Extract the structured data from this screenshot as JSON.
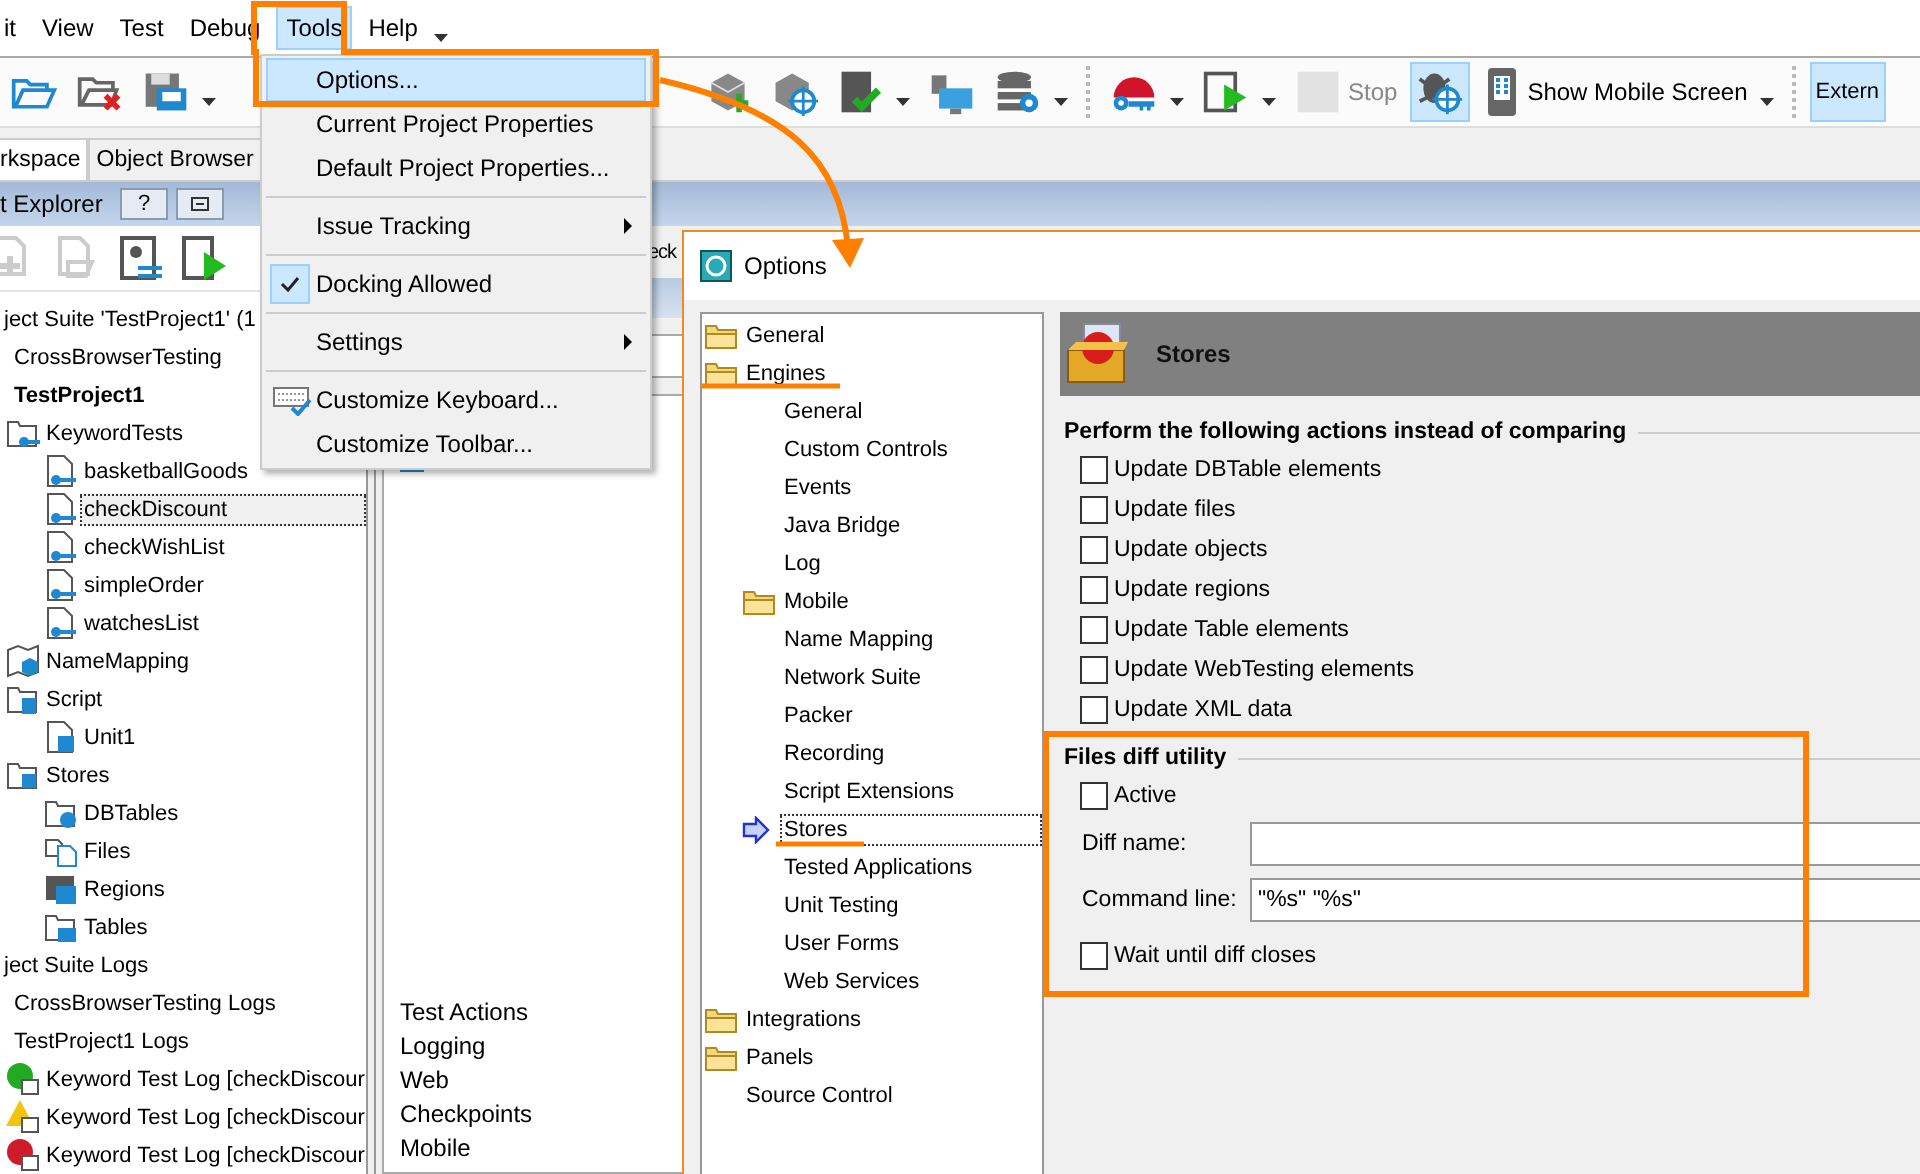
{
  "menu_bar": {
    "items": [
      {
        "label": "it",
        "selected": false
      },
      {
        "label": "View",
        "selected": false
      },
      {
        "label": "Test",
        "selected": false
      },
      {
        "label": "Debug",
        "selected": false
      },
      {
        "label": "Tools",
        "selected": true
      },
      {
        "label": "Help",
        "selected": false
      }
    ]
  },
  "toolbar": {
    "left": [
      {
        "kind": "open"
      },
      {
        "kind": "close"
      },
      {
        "kind": "save",
        "dropdown": true
      }
    ],
    "right": [
      {
        "kind": "cube-add"
      },
      {
        "kind": "cube-target"
      },
      {
        "kind": "check-doc",
        "dropdown": true
      },
      {
        "kind": "monitor"
      },
      {
        "kind": "db-gear",
        "dropdown": true
      },
      {
        "kind": "separator"
      },
      {
        "kind": "key",
        "dropdown": true
      },
      {
        "kind": "play-doc",
        "dropdown": true
      },
      {
        "kind": "stop",
        "label": "Stop",
        "disabled": true
      },
      {
        "kind": "bug-target",
        "pressed": true
      },
      {
        "kind": "phone",
        "label": "Show Mobile Screen",
        "dropdown": true
      },
      {
        "kind": "separator"
      },
      {
        "kind": "text",
        "label": "Extern",
        "pressed": true
      }
    ]
  },
  "tabs": [
    {
      "label": "rkspace",
      "selected": true
    },
    {
      "label": "Object Browser",
      "selected": false
    }
  ],
  "project_explorer": {
    "title": "t Explorer",
    "help_button": "?",
    "toolbar": [
      {
        "kind": "add",
        "disabled": true
      },
      {
        "kind": "import",
        "disabled": true
      },
      {
        "kind": "run-list",
        "disabled": false
      },
      {
        "kind": "run",
        "disabled": false
      }
    ],
    "tree": [
      {
        "label": "ject Suite 'TestProject1' (1",
        "selected": false,
        "children": [
          {
            "label": "CrossBrowserTesting",
            "selected": false
          },
          {
            "label": "TestProject1",
            "kind": "active-project",
            "selected": false,
            "children": [
              {
                "label": "KeywordTests",
                "kind": "keyword-folder",
                "selected": false,
                "children": [
                  {
                    "label": "basketballGoods",
                    "kind": "keyword-test",
                    "selected": false
                  },
                  {
                    "label": "checkDiscount",
                    "kind": "keyword-test",
                    "selected": true
                  },
                  {
                    "label": "checkWishList",
                    "kind": "keyword-test",
                    "selected": false
                  },
                  {
                    "label": "simpleOrder",
                    "kind": "keyword-test",
                    "selected": false
                  },
                  {
                    "label": "watchesList",
                    "kind": "keyword-test",
                    "selected": false
                  }
                ]
              },
              {
                "label": "NameMapping",
                "kind": "map",
                "selected": false
              },
              {
                "label": "Script",
                "kind": "script-folder",
                "selected": false,
                "children": [
                  {
                    "label": "Unit1",
                    "kind": "script",
                    "selected": false
                  }
                ]
              },
              {
                "label": "Stores",
                "kind": "stores",
                "selected": false,
                "children": [
                  {
                    "label": "DBTables",
                    "kind": "db-folder",
                    "selected": false
                  },
                  {
                    "label": "Files",
                    "kind": "files",
                    "selected": false
                  },
                  {
                    "label": "Regions",
                    "kind": "regions",
                    "selected": false
                  },
                  {
                    "label": "Tables",
                    "kind": "table-folder",
                    "selected": false
                  }
                ]
              }
            ]
          }
        ]
      },
      {
        "label": "ject Suite Logs",
        "selected": false,
        "children": [
          {
            "label": "CrossBrowserTesting Logs",
            "selected": false
          },
          {
            "label": "TestProject1 Logs",
            "selected": false,
            "children": [
              {
                "label": "Keyword Test Log [checkDiscour",
                "kind": "log-passed",
                "selected": false
              },
              {
                "label": "Keyword Test Log [checkDiscour",
                "kind": "log-warning",
                "selected": false
              },
              {
                "label": "Keyword Test Log [checkDiscour",
                "kind": "log-failed",
                "selected": false
              }
            ]
          }
        ]
      }
    ]
  },
  "middle_panel": {
    "tab": "eck",
    "items": [
      "Test Actions",
      "Logging",
      "Web",
      "Checkpoints",
      "Mobile"
    ]
  },
  "tools_menu": {
    "items": [
      {
        "kind": "item",
        "label": "Options...",
        "selected": true
      },
      {
        "kind": "item",
        "label": "Current Project Properties",
        "selected": false
      },
      {
        "kind": "item",
        "label": "Default Project Properties...",
        "selected": false
      },
      {
        "kind": "separator"
      },
      {
        "kind": "submenu",
        "label": "Issue Tracking",
        "selected": false
      },
      {
        "kind": "separator"
      },
      {
        "kind": "check",
        "label": "Docking Allowed",
        "checked": true,
        "selected": false
      },
      {
        "kind": "separator"
      },
      {
        "kind": "submenu",
        "label": "Settings",
        "selected": false
      },
      {
        "kind": "separator"
      },
      {
        "kind": "keyboard",
        "label": "Customize Keyboard...",
        "selected": false
      },
      {
        "kind": "item",
        "label": "Customize Toolbar...",
        "selected": false
      }
    ]
  },
  "options_dialog": {
    "title": "Options",
    "tree": [
      {
        "label": "General",
        "kind": "folder",
        "selected": false
      },
      {
        "label": "Engines",
        "kind": "folder",
        "selected": false,
        "children": [
          {
            "label": "General",
            "kind": "page",
            "selected": false
          },
          {
            "label": "Custom Controls",
            "kind": "page",
            "selected": false
          },
          {
            "label": "Events",
            "kind": "page",
            "selected": false
          },
          {
            "label": "Java Bridge",
            "kind": "page",
            "selected": false
          },
          {
            "label": "Log",
            "kind": "page",
            "selected": false
          },
          {
            "label": "Mobile",
            "kind": "folder",
            "selected": false
          },
          {
            "label": "Name Mapping",
            "kind": "page",
            "selected": false
          },
          {
            "label": "Network Suite",
            "kind": "page",
            "selected": false
          },
          {
            "label": "Packer",
            "kind": "page",
            "selected": false
          },
          {
            "label": "Recording",
            "kind": "page",
            "selected": false
          },
          {
            "label": "Script Extensions",
            "kind": "page",
            "selected": false
          },
          {
            "label": "Stores",
            "kind": "page",
            "selected": true
          },
          {
            "label": "Tested Applications",
            "kind": "page",
            "selected": false
          },
          {
            "label": "Unit Testing",
            "kind": "page",
            "selected": false
          },
          {
            "label": "User Forms",
            "kind": "page",
            "selected": false
          },
          {
            "label": "Web Services",
            "kind": "page",
            "selected": false
          }
        ]
      },
      {
        "label": "Integrations",
        "kind": "folder",
        "selected": false
      },
      {
        "label": "Panels",
        "kind": "folder",
        "selected": false
      },
      {
        "label": "Source Control",
        "kind": "page",
        "selected": false
      }
    ],
    "page_title": "Stores",
    "compare_group": {
      "title": "Perform the following actions instead of comparing",
      "options": [
        {
          "label": "Update DBTable elements",
          "checked": false
        },
        {
          "label": "Update files",
          "checked": false
        },
        {
          "label": "Update objects",
          "checked": false
        },
        {
          "label": "Update regions",
          "checked": false
        },
        {
          "label": "Update Table elements",
          "checked": false
        },
        {
          "label": "Update WebTesting elements",
          "checked": false
        },
        {
          "label": "Update XML data",
          "checked": false
        }
      ]
    },
    "diff_group": {
      "title": "Files diff utility",
      "active": {
        "label": "Active",
        "checked": false
      },
      "diff_name": {
        "label": "Diff name:"
      },
      "command_line": {
        "label": "Command line:",
        "value": "\"%s\" \"%s\""
      },
      "wait": {
        "label": "Wait until diff closes",
        "checked": false
      }
    }
  }
}
